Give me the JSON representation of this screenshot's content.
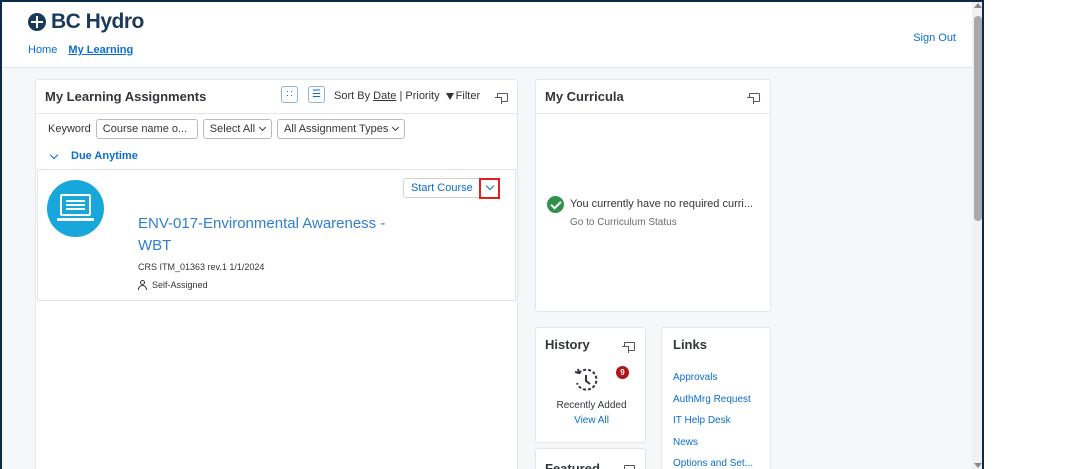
{
  "header": {
    "brand": "BC Hydro",
    "breadcrumb": [
      "Home",
      "My Learning"
    ],
    "sign_out": "Sign Out"
  },
  "assignments": {
    "title": "My Learning Assignments",
    "sort_label": "Sort By",
    "sort_date": "Date",
    "sort_sep": "|",
    "sort_priority": "Priority",
    "filter_label": "Filter",
    "keyword_label": "Keyword",
    "keyword_placeholder": "Course name o...",
    "select_all": "Select All",
    "assignment_types": "All Assignment Types",
    "group_label": "Due Anytime",
    "course": {
      "title": "ENV-017-Environmental Awareness - WBT",
      "meta": "CRS ITM_01363 rev.1 1/1/2024",
      "assigned": "Self-Assigned",
      "start_label": "Start Course"
    }
  },
  "curricula": {
    "title": "My Curricula",
    "message": "You currently have no required curri...",
    "link": "Go to Curriculum Status"
  },
  "history": {
    "title": "History",
    "badge": "9",
    "recent": "Recently Added",
    "view_all": "View All"
  },
  "featured": {
    "title": "Featured"
  },
  "links": {
    "title": "Links",
    "items": [
      "Approvals",
      "AuthMrg Request",
      "IT Help Desk",
      "News",
      "Options and Set..."
    ]
  },
  "colors": {
    "accent": "#0a6ed1",
    "course_image": "#18a7db",
    "badge": "#b0141a",
    "success": "#30914c",
    "highlight": "#e0201c"
  },
  "icons": [
    "bc-hydro-logo-icon",
    "grid-view-icon",
    "list-view-icon",
    "filter-icon",
    "expand-icon",
    "chevron-down-icon",
    "person-icon",
    "check-circle-icon",
    "history-icon"
  ]
}
